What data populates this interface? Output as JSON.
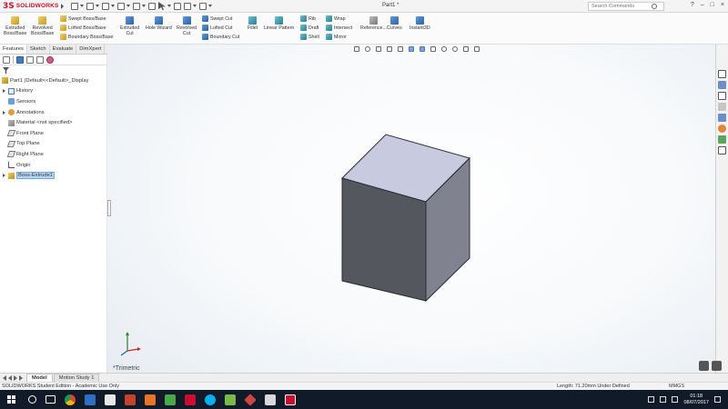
{
  "title_bar": {
    "app_name": "SOLIDWORKS",
    "document_title": "Part1 *",
    "search_placeholder": "Search Commands",
    "controls": [
      "?",
      "–",
      "□",
      "×"
    ]
  },
  "command_manager": {
    "extruded_boss": "Extruded\nBoss/Base",
    "revolved_boss": "Revolved\nBoss/Base",
    "swept_boss": "Swept Boss/Base",
    "lofted_boss": "Lofted Boss/Base",
    "boundary_boss": "Boundary Boss/Base",
    "extruded_cut": "Extruded\nCut",
    "hole_wizard": "Hole Wizard",
    "revolved_cut": "Revolved\nCut",
    "swept_cut": "Swept Cut",
    "lofted_cut": "Lofted Cut",
    "boundary_cut": "Boundary Cut",
    "fillet": "Fillet",
    "linear_pattern": "Linear Pattern",
    "rib": "Rib",
    "draft": "Draft",
    "shell": "Shell",
    "wrap": "Wrap",
    "intersect": "Intersect",
    "mirror": "Mirror",
    "reference_geometry": "Reference...",
    "curves": "Curves",
    "instant3d": "Instant3D"
  },
  "manager_tabs": [
    "Features",
    "Sketch",
    "Evaluate",
    "DimXpert"
  ],
  "feature_tree": {
    "part": "Part1 (Default<<Default>_Display",
    "items": [
      {
        "label": "History",
        "icon": "history-icon",
        "expandable": true
      },
      {
        "label": "Sensors",
        "icon": "sensor-icon",
        "expandable": false
      },
      {
        "label": "Annotations",
        "icon": "annotation-icon",
        "expandable": true
      },
      {
        "label": "Material <not specified>",
        "icon": "material-icon",
        "expandable": false
      },
      {
        "label": "Front Plane",
        "icon": "plane-icon",
        "expandable": false
      },
      {
        "label": "Top Plane",
        "icon": "plane-icon",
        "expandable": false
      },
      {
        "label": "Right Plane",
        "icon": "plane-icon",
        "expandable": false
      },
      {
        "label": "Origin",
        "icon": "origin-icon",
        "expandable": false
      },
      {
        "label": "Boss-Extrude1",
        "icon": "boss-extrude-icon",
        "expandable": true,
        "selected": true
      }
    ]
  },
  "viewport": {
    "view_label": "*Trimetric",
    "cube_colors": {
      "top": "#c8cbe0",
      "front": "#55575f",
      "right": "#80828f"
    }
  },
  "bottom_tabs": [
    "Model",
    "Motion Study 1"
  ],
  "status_bar": {
    "product": "SOLIDWORKS Student Edition - Academic Use Only",
    "measure": "Length: 71.20mm  Under Defined",
    "units": "MMGS"
  },
  "taskbar": {
    "time": "01:18",
    "date": "08/07/2017"
  }
}
